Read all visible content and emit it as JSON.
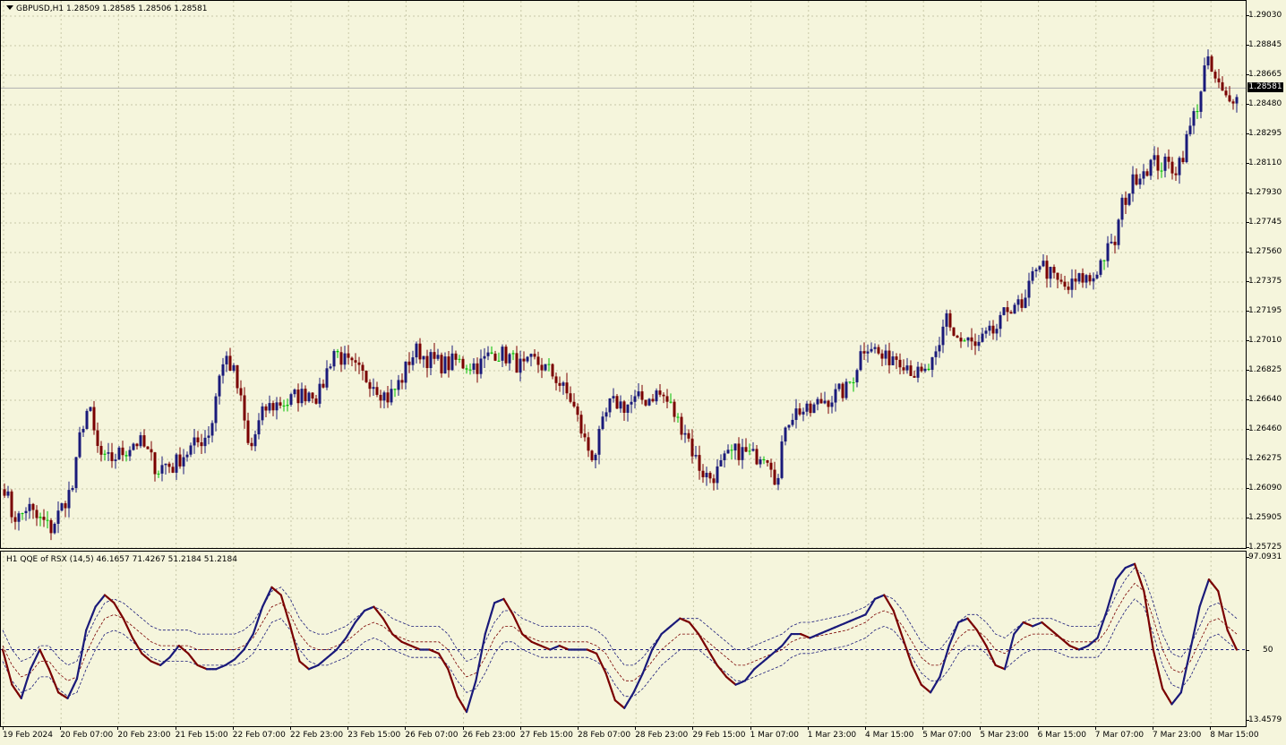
{
  "symbol_header": {
    "text": "GBPUSD,H1  1.28509 1.28585 1.28506 1.28581"
  },
  "indicator_header": {
    "text": "H1 QQE of RSX (14,5) 46.1657 71.4267 51.2184 51.2184"
  },
  "current_price": "1.28581",
  "price_axis": [
    "1.29030",
    "1.28845",
    "1.28665",
    "1.28480",
    "1.28295",
    "1.28110",
    "1.27930",
    "1.27745",
    "1.27560",
    "1.27375",
    "1.27195",
    "1.27010",
    "1.26825",
    "1.26640",
    "1.26460",
    "1.26275",
    "1.26090",
    "1.25905",
    "1.25725"
  ],
  "osc_axis": {
    "top": "97.0931",
    "mid": "50",
    "bottom": "13.4579"
  },
  "time_axis": [
    "19 Feb 2024",
    "20 Feb 07:00",
    "20 Feb 23:00",
    "21 Feb 15:00",
    "22 Feb 07:00",
    "22 Feb 23:00",
    "23 Feb 15:00",
    "26 Feb 07:00",
    "26 Feb 23:00",
    "27 Feb 15:00",
    "28 Feb 07:00",
    "28 Feb 23:00",
    "29 Feb 15:00",
    "1 Mar 07:00",
    "1 Mar 23:00",
    "4 Mar 15:00",
    "5 Mar 07:00",
    "5 Mar 23:00",
    "6 Mar 15:00",
    "7 Mar 07:00",
    "7 Mar 23:00",
    "8 Mar 15:00"
  ],
  "colors": {
    "background": "#f5f5dc",
    "grid": "#c8c8a8",
    "bull": "#1a1a7a",
    "bear": "#7a0000",
    "green": "#00c000"
  },
  "chart_data": [
    {
      "type": "candlestick",
      "symbol": "GBPUSD",
      "timeframe": "H1",
      "ylim": [
        1.25725,
        1.2903
      ],
      "x_labels_start": "19 Feb 2024",
      "close_path": [
        1.261,
        1.2592,
        1.259,
        1.2598,
        1.259,
        1.2588,
        1.2583,
        1.2592,
        1.2602,
        1.261,
        1.2646,
        1.266,
        1.2635,
        1.2625,
        1.2627,
        1.263,
        1.2633,
        1.2638,
        1.2636,
        1.2628,
        1.262,
        1.2624,
        1.2622,
        1.2628,
        1.2632,
        1.2636,
        1.264,
        1.2646,
        1.268,
        1.269,
        1.268,
        1.266,
        1.263,
        1.2646,
        1.2658,
        1.266,
        1.2662,
        1.2662,
        1.2666,
        1.2667,
        1.267,
        1.2665,
        1.268,
        1.2695,
        1.269,
        1.2685,
        1.2682,
        1.2678,
        1.2676,
        1.267,
        1.2665,
        1.267,
        1.2678,
        1.269,
        1.2695,
        1.269,
        1.2688,
        1.2686,
        1.2686,
        1.2688,
        1.2686,
        1.2686,
        1.2685,
        1.269,
        1.2694,
        1.2692,
        1.269,
        1.2686,
        1.2683,
        1.2688,
        1.2686,
        1.2682,
        1.2678,
        1.267,
        1.2664,
        1.265,
        1.2635,
        1.2628,
        1.2645,
        1.266,
        1.2662,
        1.266,
        1.2662,
        1.2664,
        1.2664,
        1.2668,
        1.2666,
        1.266,
        1.265,
        1.2645,
        1.263,
        1.262,
        1.2615,
        1.2618,
        1.2625,
        1.263,
        1.2632,
        1.263,
        1.2628,
        1.2632,
        1.2628,
        1.261,
        1.265,
        1.2655,
        1.2658,
        1.2655,
        1.266,
        1.2664,
        1.2665,
        1.2668,
        1.267,
        1.268,
        1.2695,
        1.27,
        1.2693,
        1.2688,
        1.2692,
        1.269,
        1.2686,
        1.268,
        1.2678,
        1.2685,
        1.269,
        1.2718,
        1.2705,
        1.27,
        1.27,
        1.2695,
        1.2702,
        1.2705,
        1.271,
        1.272,
        1.2725,
        1.2718,
        1.2735,
        1.2752,
        1.2745,
        1.274,
        1.2735,
        1.2733,
        1.2737,
        1.274,
        1.2738,
        1.2748,
        1.2756,
        1.276,
        1.2785,
        1.2795,
        1.2805,
        1.2808,
        1.2812,
        1.281,
        1.281,
        1.2808,
        1.2818,
        1.2835,
        1.285,
        1.2875,
        1.2865,
        1.2855,
        1.2848,
        1.2858
      ]
    },
    {
      "type": "line",
      "title": "H1 QQE of RSX (14,5)",
      "ylim": [
        13.4579,
        97.0931
      ],
      "level": 50,
      "values_shown_in_header": [
        46.1657,
        71.4267,
        51.2184,
        51.2184
      ],
      "rsx_path": [
        50,
        32,
        25,
        40,
        50,
        40,
        28,
        25,
        35,
        60,
        72,
        78,
        74,
        66,
        56,
        48,
        44,
        42,
        46,
        52,
        48,
        42,
        40,
        40,
        42,
        45,
        50,
        58,
        72,
        82,
        78,
        62,
        44,
        40,
        42,
        46,
        50,
        56,
        64,
        70,
        72,
        66,
        58,
        54,
        52,
        50,
        50,
        48,
        40,
        26,
        18,
        34,
        58,
        74,
        76,
        68,
        58,
        54,
        52,
        50,
        52,
        50,
        50,
        50,
        48,
        38,
        24,
        20,
        28,
        38,
        50,
        58,
        62,
        66,
        64,
        58,
        50,
        42,
        36,
        32,
        34,
        40,
        44,
        48,
        52,
        58,
        58,
        56,
        58,
        60,
        62,
        64,
        66,
        68,
        76,
        78,
        70,
        56,
        42,
        32,
        28,
        36,
        52,
        64,
        66,
        60,
        52,
        42,
        40,
        58,
        64,
        62,
        64,
        60,
        56,
        52,
        50,
        52,
        56,
        70,
        86,
        92,
        94,
        80,
        50,
        30,
        22,
        28,
        50,
        72,
        86,
        80,
        60,
        50
      ],
      "signal_path": [
        52,
        42,
        36,
        38,
        44,
        44,
        38,
        34,
        36,
        48,
        58,
        66,
        68,
        66,
        62,
        58,
        54,
        52,
        52,
        52,
        52,
        50,
        50,
        50,
        50,
        50,
        52,
        56,
        64,
        72,
        74,
        68,
        58,
        52,
        50,
        50,
        52,
        54,
        58,
        62,
        64,
        62,
        58,
        56,
        54,
        54,
        54,
        54,
        50,
        42,
        36,
        38,
        46,
        56,
        62,
        62,
        58,
        56,
        54,
        54,
        54,
        54,
        54,
        54,
        52,
        48,
        40,
        34,
        34,
        38,
        44,
        50,
        54,
        58,
        58,
        58,
        54,
        50,
        46,
        42,
        42,
        44,
        46,
        48,
        50,
        54,
        56,
        56,
        57,
        58,
        59,
        60,
        62,
        64,
        68,
        70,
        68,
        62,
        54,
        46,
        42,
        42,
        48,
        56,
        60,
        60,
        56,
        50,
        48,
        52,
        56,
        58,
        58,
        58,
        56,
        54,
        54,
        54,
        54,
        60,
        70,
        78,
        84,
        80,
        66,
        50,
        40,
        38,
        44,
        54,
        64,
        66,
        62,
        58
      ]
    }
  ]
}
